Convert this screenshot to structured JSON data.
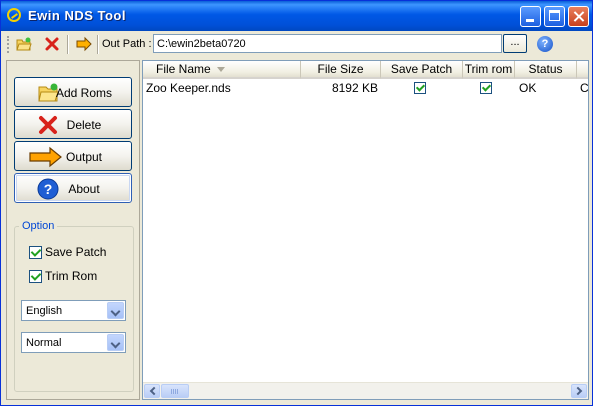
{
  "window": {
    "title": "Ewin NDS Tool"
  },
  "toolbar": {
    "out_path_label": "Out Path :",
    "out_path_value": "C:\\ewin2beta0720",
    "browse_label": "...",
    "help_glyph": "?"
  },
  "left_panel": {
    "buttons": [
      {
        "label": "Add Roms",
        "icon": "folder-open-icon"
      },
      {
        "label": "Delete",
        "icon": "red-x-icon"
      },
      {
        "label": "Output",
        "icon": "orange-arrow-icon"
      },
      {
        "label": "About",
        "icon": "help-icon"
      }
    ],
    "option_group": {
      "title": "Option",
      "save_patch": {
        "label": "Save Patch",
        "checked": true
      },
      "trim_rom": {
        "label": "Trim Rom",
        "checked": true
      },
      "language": "English",
      "mode": "Normal"
    }
  },
  "list": {
    "columns": [
      "File Name",
      "File Size",
      "Save Patch",
      "Trim rom",
      "Status",
      "C"
    ],
    "rows": [
      {
        "file_name": "Zoo Keeper.nds",
        "file_size": "8192 KB",
        "save_patch": true,
        "trim_rom": true,
        "status": "OK",
        "extra": "C"
      }
    ]
  },
  "colors": {
    "title_bar": "#0058e6",
    "window_face": "#ece9d8",
    "accent": "#0046d5"
  }
}
